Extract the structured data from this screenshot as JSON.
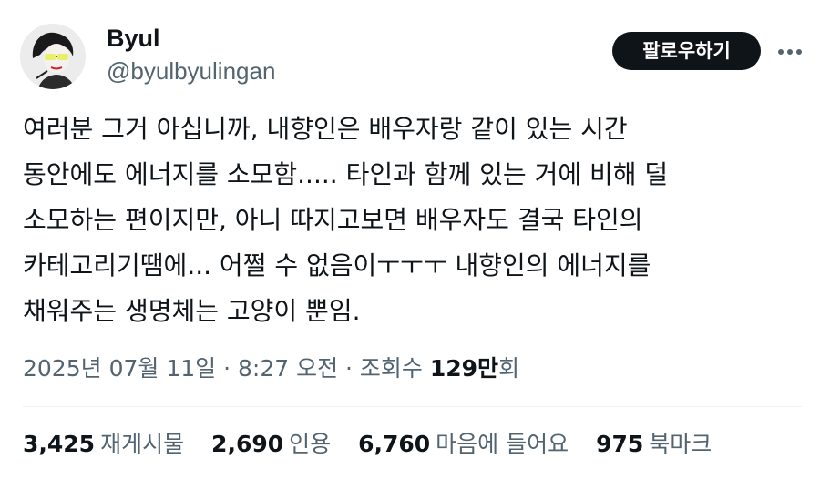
{
  "author": {
    "name": "Byul",
    "handle": "@byulbyulingan",
    "avatar_icon": "profile-avatar"
  },
  "actions": {
    "follow_label": "팔로우하기",
    "more_icon": "more-horizontal-icon"
  },
  "post": {
    "lines": [
      "여러분 그거 아십니까, 내향인은 배우자랑 같이 있는 시간",
      "동안에도 에너지를 소모함..... 타인과 함께 있는 거에 비해 덜",
      "소모하는 편이지만, 아니 따지고보면 배우자도 결국 타인의",
      "카테고리기땜에... 어쩔 수 없음이ㅜㅜㅜ 내향인의 에너지를",
      "채워주는 생명체는 고양이 뿐임."
    ]
  },
  "meta": {
    "date": "2025년 07월 11일",
    "sep1": " · ",
    "time": "8:27 오전",
    "sep2": " · ",
    "views_label": "조회수 ",
    "views_number": "129만",
    "views_suffix": "회"
  },
  "stats": [
    {
      "value": "3,425",
      "label": "재게시물"
    },
    {
      "value": "2,690",
      "label": "인용"
    },
    {
      "value": "6,760",
      "label": "마음에 들어요"
    },
    {
      "value": "975",
      "label": "북마크"
    }
  ],
  "colors": {
    "text": "#0f1419",
    "secondary": "#536471",
    "follow_bg": "#0f1419",
    "follow_text": "#ffffff",
    "divider": "#eff3f4"
  }
}
